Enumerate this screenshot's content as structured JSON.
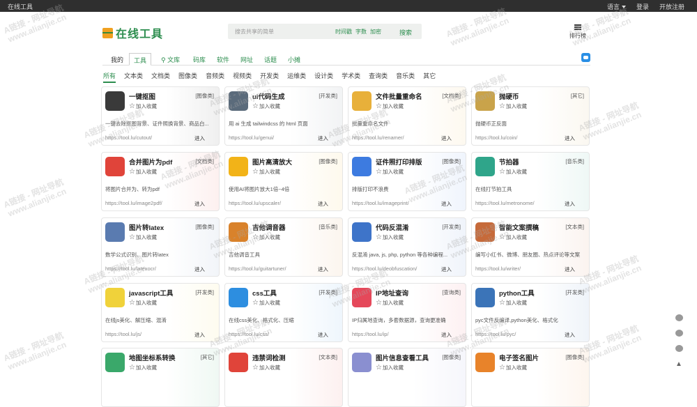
{
  "topbar": {
    "brand": "在线工具",
    "language": "语言",
    "login": "登录",
    "register": "开放注册"
  },
  "logo": {
    "text": "在线工具"
  },
  "search": {
    "placeholder": "搜去共享的简单",
    "options": [
      "时间戳",
      "字数",
      "加密"
    ],
    "button": "搜索"
  },
  "rank": {
    "label": "排行榜"
  },
  "nav": {
    "tabs": [
      "我的",
      "工具",
      "文库",
      "码库",
      "软件",
      "网址",
      "话题",
      "小摊"
    ],
    "active": 1
  },
  "categories": {
    "items": [
      "所有",
      "文本类",
      "文档类",
      "图像类",
      "音频类",
      "视频类",
      "开发类",
      "运维类",
      "设计类",
      "学术类",
      "查询类",
      "音乐类",
      "其它"
    ],
    "active": 0
  },
  "common": {
    "fav": "加入收藏",
    "go": "进入"
  },
  "watermark": {
    "line1": "A链接 - 网址导航",
    "line2": "www.alianjie.cn"
  },
  "tools": [
    {
      "title": "一键抠图",
      "tag": "[图像类]",
      "desc": "一键去除抠图背景、证件照换背景、商品白...",
      "url": "https://tool.lu/cutout/",
      "icon": "portrait-icon",
      "color": "#3a3a3a"
    },
    {
      "title": "ui代码生成",
      "tag": "[开发类]",
      "desc": "用 ai 生成 tailwindcss 的 html 页面",
      "url": "https://tool.lu/genui/",
      "icon": "cat-icon",
      "color": "#5b6b7b"
    },
    {
      "title": "文件批量重命名",
      "tag": "[文档类]",
      "desc": "批量重命名文件",
      "url": "https://tool.lu/renamer/",
      "icon": "folder-icon",
      "color": "#e8b03a"
    },
    {
      "title": "抛硬币",
      "tag": "[其它]",
      "desc": "抛硬币正反面",
      "url": "https://tool.lu/coin/",
      "icon": "coin-icon",
      "color": "#c9a34a"
    },
    {
      "title": "合并图片为pdf",
      "tag": "[文档类]",
      "desc": "将图片合并为、转为pdf",
      "url": "https://tool.lu/image2pdf/",
      "icon": "pdf-icon",
      "color": "#e0443a"
    },
    {
      "title": "图片高清放大",
      "tag": "[图像类]",
      "desc": "使用AI将图片放大1倍~4倍",
      "url": "https://tool.lu/upscaler/",
      "icon": "image-icon",
      "color": "#f2b318"
    },
    {
      "title": "证件照打印排版",
      "tag": "[图像类]",
      "desc": "排版打印不浪费",
      "url": "https://tool.lu/imageprint/",
      "icon": "layout-icon",
      "color": "#3d7be0"
    },
    {
      "title": "节拍器",
      "tag": "[音乐类]",
      "desc": "在线打节拍工具",
      "url": "https://tool.lu/metronome/",
      "icon": "metronome-icon",
      "color": "#2fa58a"
    },
    {
      "title": "图片转latex",
      "tag": "[图像类]",
      "desc": "数学公式识别、图片转latex",
      "url": "https://tool.lu/latexocr/",
      "icon": "formula-icon",
      "color": "#5a7bb0"
    },
    {
      "title": "吉他调音器",
      "tag": "[音乐类]",
      "desc": "吉他调音工具",
      "url": "https://tool.lu/guitartuner/",
      "icon": "guitar-icon",
      "color": "#d9822b"
    },
    {
      "title": "代码反混淆",
      "tag": "[开发类]",
      "desc": "反混淆 java, js, php, python 等各种编程...",
      "url": "https://tool.lu/deobfuscation/",
      "icon": "code-icon",
      "color": "#3e74c9"
    },
    {
      "title": "智能文案撰稿",
      "tag": "[文本类]",
      "desc": "编写小红书、微博、朋友圈、热点评论等文案",
      "url": "https://tool.lu/writer/",
      "icon": "pen-icon",
      "color": "#c66a3a"
    },
    {
      "title": "javascript工具",
      "tag": "[开发类]",
      "desc": "在线js美化、解压缩、混淆",
      "url": "https://tool.lu/js/",
      "icon": "js-icon",
      "color": "#f0d23a"
    },
    {
      "title": "css工具",
      "tag": "[开发类]",
      "desc": "在线css美化、格式化、压缩",
      "url": "https://tool.lu/css/",
      "icon": "css-icon",
      "color": "#2d8ee0"
    },
    {
      "title": "IP地址查询",
      "tag": "[查询类]",
      "desc": "IP归属地查询，多套数据源，查询更准确",
      "url": "https://tool.lu/ip/",
      "icon": "location-icon",
      "color": "#e5485a"
    },
    {
      "title": "python工具",
      "tag": "[开发类]",
      "desc": "pyc文件反编译,python美化、格式化",
      "url": "https://tool.lu/pyc/",
      "icon": "python-icon",
      "color": "#3b74b8"
    },
    {
      "title": "地图坐标系转换",
      "tag": "[其它]",
      "desc": "",
      "url": "",
      "icon": "map-icon",
      "color": "#3aa86a"
    },
    {
      "title": "违禁词检测",
      "tag": "[文本类]",
      "desc": "",
      "url": "",
      "icon": "ban-icon",
      "color": "#e0443a"
    },
    {
      "title": "图片信息查看工具",
      "tag": "[图像类]",
      "desc": "",
      "url": "",
      "icon": "exif-icon",
      "color": "#8a8fd0"
    },
    {
      "title": "电子签名图片",
      "tag": "[图像类]",
      "desc": "",
      "url": "",
      "icon": "feather-icon",
      "color": "#e8832a"
    }
  ]
}
